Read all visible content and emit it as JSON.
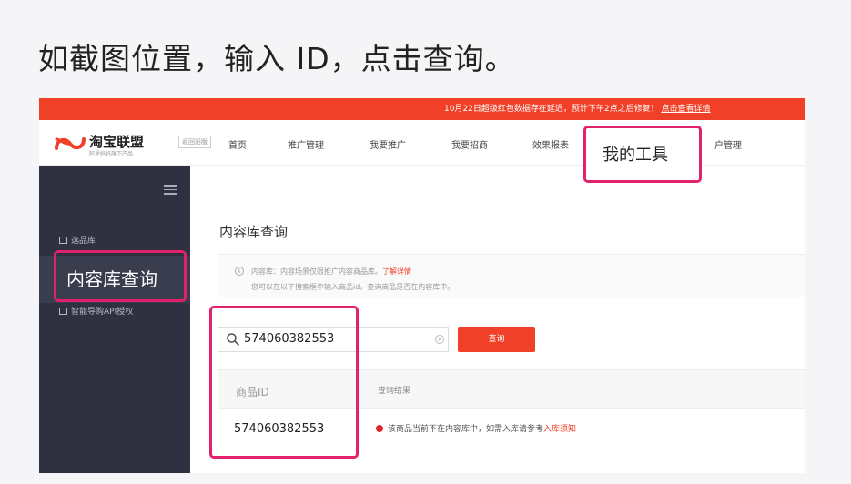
{
  "slide_title": "如截图位置，输入 ID，点击查询。",
  "notice": {
    "message": "10月22日超级红包数据存在延迟，预计下午2点之后修复！",
    "link": "点击查看详情"
  },
  "logo": {
    "name": "淘宝联盟",
    "slogan": "阿里妈妈旗下产品",
    "old_version": "返回旧版"
  },
  "nav": {
    "items": [
      "首页",
      "推广管理",
      "我要推广",
      "我要招商",
      "效果报表",
      "我的工具",
      "账户管理"
    ],
    "account_partial": "户管理"
  },
  "sidebar": {
    "items": [
      "选品库",
      "内容库查询",
      "智能导购API授权"
    ]
  },
  "main": {
    "heading": "内容库查询",
    "info_line1": "内容库：内容场景仅限推广内容商品库。",
    "info_link": "了解详情",
    "info_line2": "您可以在以下搜索框中输入商品id，查询商品是否在内容库中。",
    "search_value": "574060382553",
    "search_button": "查询",
    "table": {
      "col_id": "商品ID",
      "col_result": "查询结果",
      "row_id": "574060382553",
      "row_result": "该商品当前不在内容库中，如需入库请参考",
      "row_link": "入库须知"
    }
  },
  "colors": {
    "accent": "#f04128",
    "highlight": "#e0226d",
    "sidebar": "#2f3140"
  }
}
